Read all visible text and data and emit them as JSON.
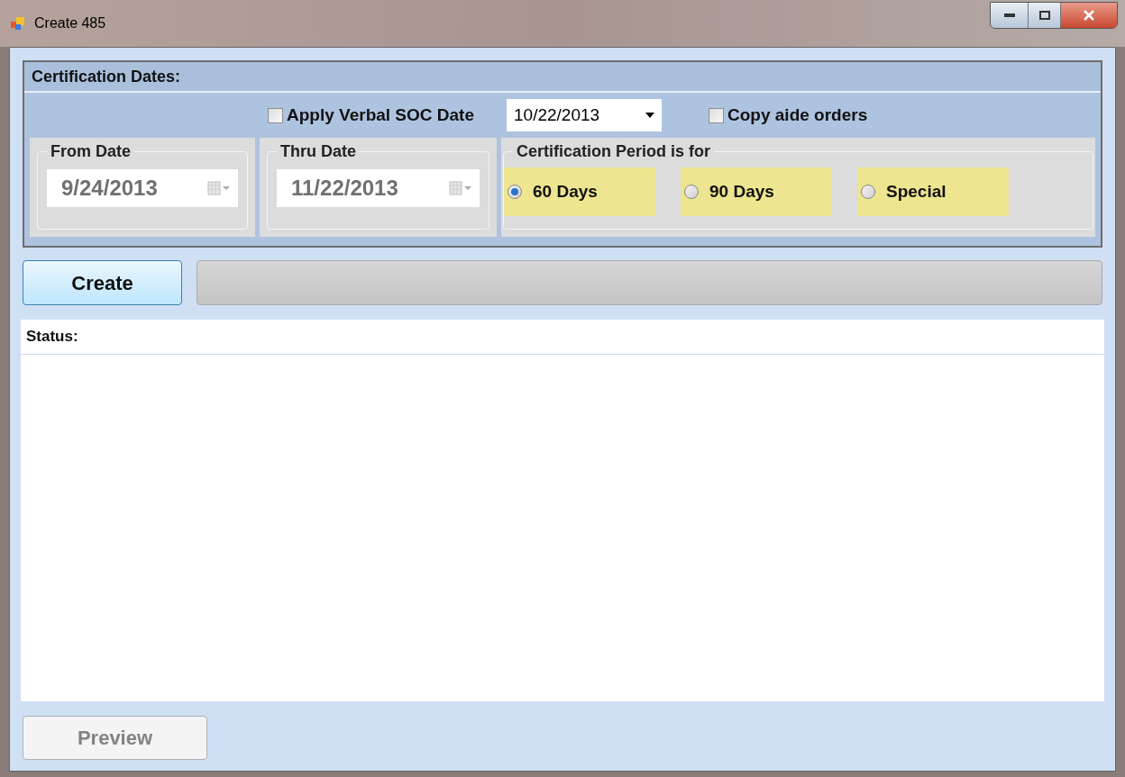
{
  "window": {
    "title": "Create 485"
  },
  "certification": {
    "title": "Certification Dates:",
    "verbal_soc": {
      "label": "Apply Verbal SOC Date",
      "checked": false
    },
    "verbal_date": {
      "value": "10/22/2013"
    },
    "copy_aide": {
      "label": "Copy aide orders",
      "checked": false
    },
    "from_date": {
      "label": "From Date",
      "value": "9/24/2013",
      "disabled": true
    },
    "thru_date": {
      "label": "Thru Date",
      "value": "11/22/2013",
      "disabled": true
    },
    "period": {
      "label": "Certification Period is for",
      "options": [
        {
          "label": "60 Days",
          "selected": true
        },
        {
          "label": "90 Days",
          "selected": false
        },
        {
          "label": "Special",
          "selected": false
        }
      ]
    }
  },
  "create_button": {
    "label": "Create"
  },
  "progress": {
    "level": 0
  },
  "status": {
    "label": "Status:"
  },
  "preview_button": {
    "label": "Preview",
    "disabled": true
  }
}
